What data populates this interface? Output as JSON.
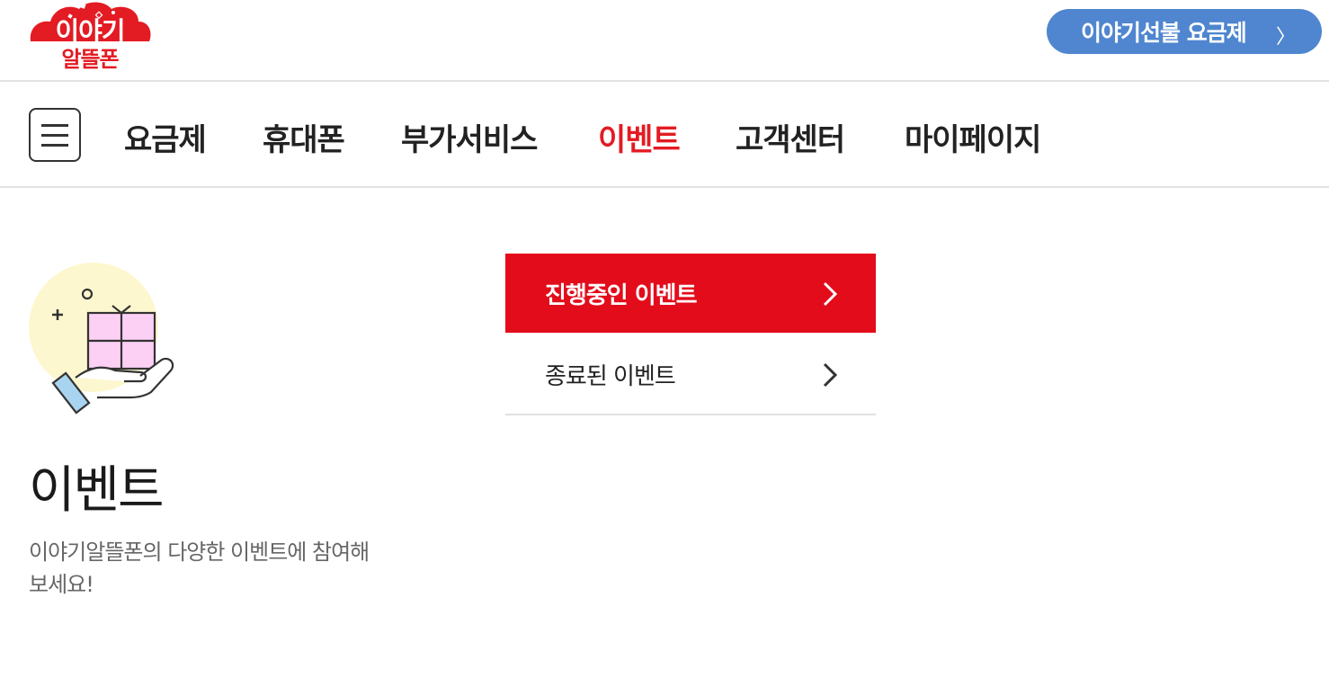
{
  "header": {
    "logo_line1": "이야기",
    "logo_line2": "알뜰폰",
    "promo_label": "이야기선불 요금제",
    "promo_chevron": "〉"
  },
  "nav": {
    "menu_icon": "hamburger-icon",
    "items": [
      {
        "label": "요금제"
      },
      {
        "label": "휴대폰"
      },
      {
        "label": "부가서비스"
      },
      {
        "label": "이벤트",
        "active": true
      },
      {
        "label": "고객센터"
      },
      {
        "label": "마이페이지"
      }
    ]
  },
  "hero": {
    "icon": "gift-hand-icon",
    "title": "이벤트",
    "description": "이야기알뜰폰의 다양한 이벤트에 참여해 보세요!"
  },
  "submenu": {
    "items": [
      {
        "label": "진행중인 이벤트",
        "active": true
      },
      {
        "label": "종료된 이벤트",
        "active": false
      }
    ]
  },
  "colors": {
    "brand_red": "#e31b23",
    "active_bg": "#e30c1b",
    "promo_blue": "#4f86cf"
  }
}
